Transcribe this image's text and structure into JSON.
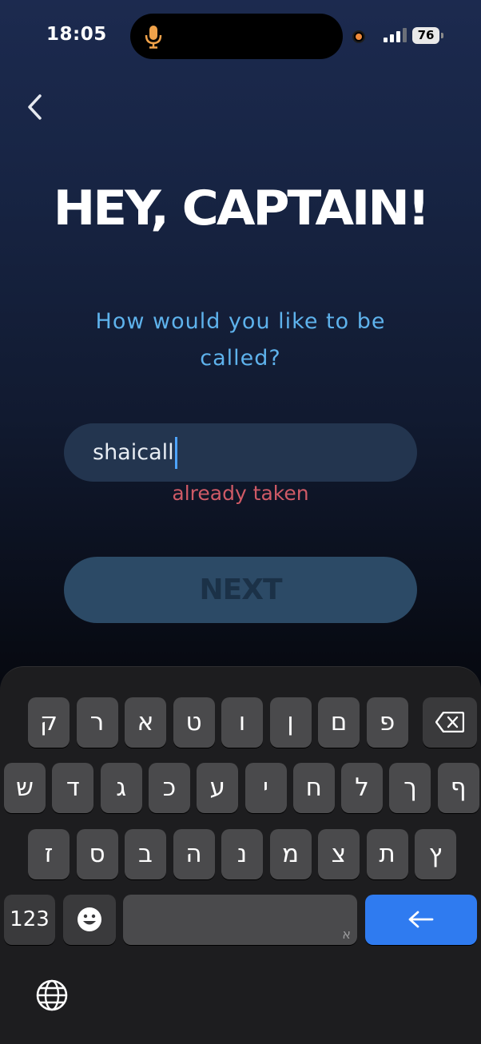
{
  "status_bar": {
    "time": "18:05",
    "battery": "76"
  },
  "header": {
    "back_icon": "chevron-left-icon"
  },
  "main": {
    "title": "HEY, CAPTAIN!",
    "subtitle": "How would you like to be called?",
    "username_value": "shaicall",
    "error": "already taken",
    "next_label": "NEXT"
  },
  "keyboard": {
    "row1": [
      "ק",
      "ר",
      "א",
      "ט",
      "ו",
      "ן",
      "ם",
      "פ"
    ],
    "row2": [
      "ש",
      "ד",
      "ג",
      "כ",
      "ע",
      "י",
      "ח",
      "ל",
      "ך",
      "ף"
    ],
    "row3": [
      "ז",
      "ס",
      "ב",
      "ה",
      "נ",
      "מ",
      "צ",
      "ת",
      "ץ"
    ],
    "numbers_label": "123",
    "space_hint": "א",
    "emoji_icon": "emoji-icon",
    "delete_icon": "backspace-icon",
    "return_icon": "return-arrow-icon",
    "globe_icon": "globe-icon"
  },
  "colors": {
    "accent": "#5eb2ec",
    "error": "#cf5a66",
    "return_key": "#2f7bf0"
  }
}
